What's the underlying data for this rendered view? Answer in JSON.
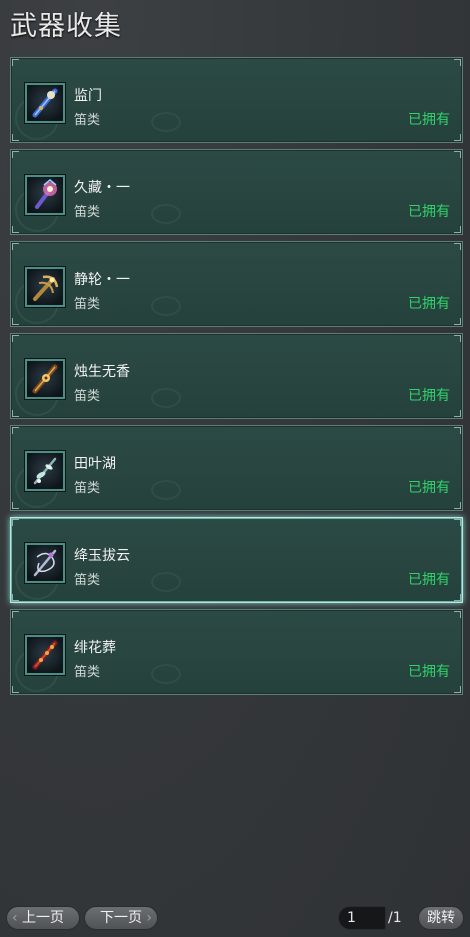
{
  "title": "武器收集",
  "items": [
    {
      "name": "监门",
      "category": "笛类",
      "status": "已拥有",
      "icon": "flute-blue-icon",
      "selected": false
    },
    {
      "name": "久藏・一",
      "category": "笛类",
      "status": "已拥有",
      "icon": "flute-crystal-icon",
      "selected": false
    },
    {
      "name": "静轮・一",
      "category": "笛类",
      "status": "已拥有",
      "icon": "flute-gold-icon",
      "selected": false
    },
    {
      "name": "烛生无香",
      "category": "笛类",
      "status": "已拥有",
      "icon": "flute-amber-icon",
      "selected": false
    },
    {
      "name": "田叶湖",
      "category": "笛类",
      "status": "已拥有",
      "icon": "flute-leaf-icon",
      "selected": false
    },
    {
      "name": "绛玉拔云",
      "category": "笛类",
      "status": "已拥有",
      "icon": "flute-silver-icon",
      "selected": true
    },
    {
      "name": "绯花葬",
      "category": "笛类",
      "status": "已拥有",
      "icon": "flute-red-icon",
      "selected": false
    }
  ],
  "pagination": {
    "prev_label": "上一页",
    "next_label": "下一页",
    "current_page": "1",
    "total": "/1",
    "jump_label": "跳转"
  },
  "colors": {
    "owned_status": "#2fd36b",
    "selected_border": "#b9e7e0",
    "card_bg": "#2c4a45"
  }
}
